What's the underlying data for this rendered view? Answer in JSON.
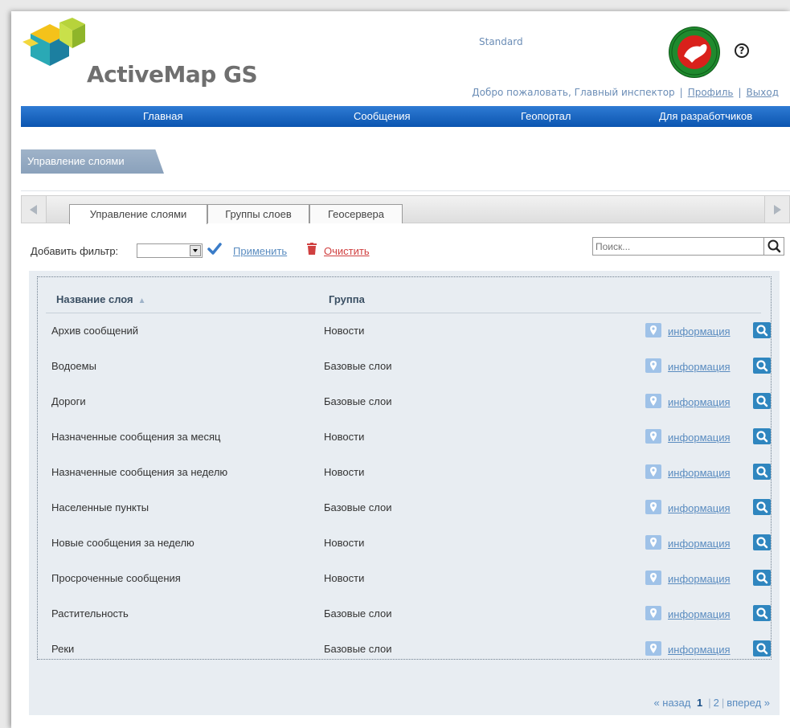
{
  "header": {
    "brand": "ActiveMap GS",
    "edition": "Standard",
    "welcome": "Добро пожаловать, Главный инспектор",
    "profile_link": "Профиль",
    "logout_link": "Выход",
    "help_glyph": "?"
  },
  "nav": {
    "items": [
      "Главная",
      "Сообщения",
      "Геопортал",
      "Для разработчиков"
    ]
  },
  "page_tab": "Управление слоями",
  "tabs": [
    "Управление слоями",
    "Группы слоев",
    "Геосервера"
  ],
  "filter": {
    "label": "Добавить фильтр:",
    "apply": "Применить",
    "clear": "Очистить"
  },
  "search": {
    "placeholder": "Поиск..."
  },
  "table": {
    "columns": [
      "Название слоя",
      "Группа"
    ],
    "sort_arrow": "▲",
    "info_label": "информация",
    "rows": [
      {
        "name": "Архив сообщений",
        "group": "Новости"
      },
      {
        "name": "Водоемы",
        "group": "Базовые слои"
      },
      {
        "name": "Дороги",
        "group": "Базовые слои"
      },
      {
        "name": "Назначенные сообщения за месяц",
        "group": "Новости"
      },
      {
        "name": "Назначенные сообщения за неделю",
        "group": "Новости"
      },
      {
        "name": "Населенные пункты",
        "group": "Базовые слои"
      },
      {
        "name": "Новые сообщения за неделю",
        "group": "Новости"
      },
      {
        "name": "Просроченные сообщения",
        "group": "Новости"
      },
      {
        "name": "Растительность",
        "group": "Базовые слои"
      },
      {
        "name": "Реки",
        "group": "Базовые слои"
      }
    ]
  },
  "pager": {
    "prev": "« назад",
    "current": "1",
    "page2": "2",
    "next": "вперед »"
  },
  "colors": {
    "nav": "#0b55b0",
    "link": "#5a8cc0",
    "zoom": "#2f86bf",
    "danger": "#d04040"
  }
}
